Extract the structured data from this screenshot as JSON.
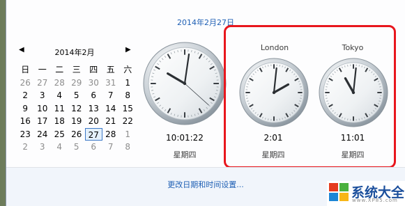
{
  "header": {
    "date": "2014年2月27日"
  },
  "calendar": {
    "title": "2014年2月",
    "prev_icon": "◀",
    "next_icon": "▶",
    "weekdays": [
      "日",
      "一",
      "二",
      "三",
      "四",
      "五",
      "六"
    ],
    "weeks": [
      [
        "26",
        "27",
        "28",
        "29",
        "30",
        "31",
        "1"
      ],
      [
        "2",
        "3",
        "4",
        "5",
        "6",
        "7",
        "8"
      ],
      [
        "9",
        "10",
        "11",
        "12",
        "13",
        "14",
        "15"
      ],
      [
        "16",
        "17",
        "18",
        "19",
        "20",
        "21",
        "22"
      ],
      [
        "23",
        "24",
        "25",
        "26",
        "27",
        "28",
        "1"
      ],
      [
        "2",
        "3",
        "4",
        "5",
        "6",
        "7",
        "8"
      ]
    ]
  },
  "clocks": [
    {
      "city": "",
      "time": "10:01:22",
      "day": "星期四",
      "hour": 10,
      "minute": 1,
      "second": 22
    },
    {
      "city": "London",
      "time": "2:01",
      "day": "星期四",
      "hour": 2,
      "minute": 1
    },
    {
      "city": "Tokyo",
      "time": "11:01",
      "day": "星期四",
      "hour": 11,
      "minute": 1
    }
  ],
  "footer": {
    "link": "更改日期和时间设置..."
  },
  "logo": {
    "text": "系统大全",
    "url": "www.XP85.com"
  },
  "colors": {
    "highlight": "#e8161d",
    "link": "#1e5fb4"
  }
}
